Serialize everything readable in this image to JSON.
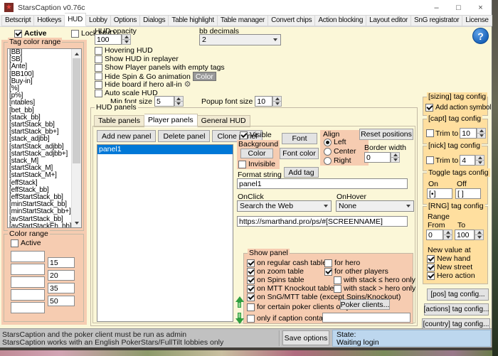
{
  "icons": {
    "app_star": "★",
    "minimize": "–",
    "maximize": "□",
    "close": "×",
    "help": "?",
    "gear": "⚙"
  },
  "colors": {
    "window_bg": "#fbf7d8",
    "panel_pink": "#f6ccb1",
    "panel_orange": "#ffdf9f",
    "selection_blue": "#0078d7",
    "state_bg": "#bdd7ee",
    "status_bg": "#c1c1c1",
    "help_blue": "#1861b8",
    "arrow_green": "#2f9e3f",
    "dark_button_gray": "#989898"
  },
  "window": {
    "title": "StarsCaption v0.76c",
    "tabs": [
      "Betscript",
      "Hotkeys",
      "HUD",
      "Lobby",
      "Options",
      "Dialogs",
      "Table highlight",
      "Table manager",
      "Convert chips",
      "Action blocking",
      "Layout editor",
      "SnG registrator",
      "License"
    ],
    "active_tab": "HUD"
  },
  "topbar": {
    "active_label": "Active",
    "lock_hud_label": "Lock HUD",
    "hud_opacity_label": "HUD opacity",
    "hud_opacity_value": "100",
    "bb_decimals_label": "bb decimals",
    "bb_decimals_value": "2",
    "opt_hovering": "Hovering HUD",
    "opt_replayer": "Show HUD in replayer",
    "opt_empty_tags": "Show Player panels with empty tags",
    "opt_spin_go": "Hide Spin & Go animation",
    "color_button": "Color",
    "opt_hide_board": "Hide board if hero all-in",
    "opt_auto_scale": "Auto scale HUD",
    "min_font_label": "Min font size",
    "min_font_value": "5",
    "popup_font_label": "Popup font size",
    "popup_font_value": "10",
    "checks": {
      "active": true,
      "lock_hud": false,
      "hovering": false,
      "replayer": false,
      "empty_tags": false,
      "spin_go": false,
      "hide_board": false,
      "auto_scale": false
    }
  },
  "tag_color_range": {
    "title": "Tag color range",
    "items": [
      "[BB]",
      "[SB]",
      "[Ante]",
      "[BB100]",
      "[Buy-in]",
      "[%]",
      "[p%]",
      "[ntables]",
      "[bet_bb]",
      "[stack_bb]",
      "[startStack_bb]",
      "[startStack_bb+]",
      "[stack_adjbb]",
      "[startStack_adjbb]",
      "[startStack_adjbb+]",
      "[stack_M]",
      "[startStack_M]",
      "[startStack_M+]",
      "[effStack]",
      "[effStack_bb]",
      "[effStartStack_bb]",
      "[minStartStack_bb]",
      "[minStartStack_bb+]",
      "[avStartStack_bb]",
      "[avStartStackEh_bb]"
    ]
  },
  "color_range": {
    "title": "Color range",
    "active_label": "Active",
    "active_checked": false,
    "values": [
      "15",
      "20",
      "35",
      "50"
    ]
  },
  "hud_panels": {
    "title": "HUD panels",
    "tabs": [
      "Table panels",
      "Player panels",
      "General HUD"
    ],
    "active_tab": "Player panels",
    "add_button": "Add new panel",
    "delete_button": "Delete panel",
    "clone_button": "Clone panel",
    "panels": [
      "panel1"
    ],
    "visible_label": "Visible",
    "visible_checked": true,
    "background_title": "Background",
    "background_color_button": "Color",
    "invisible_label": "Invisible",
    "invisible_checked": false,
    "font_button": "Font",
    "font_color_button": "Font color",
    "add_tag_button": "Add tag",
    "align_title": "Align",
    "align_left": "Left",
    "align_center": "Center",
    "align_right": "Right",
    "align_checked": {
      "left": true,
      "center": false,
      "right": false
    },
    "reset_button": "Reset positions",
    "border_width_label": "Border width",
    "border_width_value": "0",
    "format_label": "Format string",
    "format_value": "panel1",
    "onclick_label": "OnClick",
    "onclick_value": "Search the Web",
    "onhover_label": "OnHover",
    "onhover_value": "None",
    "url_value": "https://smarthand.pro/ps/#[SCREENNAME]",
    "show_panel": {
      "title": "Show panel",
      "opt_regular": "on regular cash table",
      "opt_zoom": "on zoom table",
      "opt_spins": "on Spins table",
      "opt_mtt_ko": "on MTT Knockout table",
      "opt_sng": "on SnG/MTT table (except Spins/Knockout)",
      "opt_hero": "for hero",
      "opt_others": "for other players",
      "opt_stack_le": "with stack ≤ hero only",
      "opt_stack_gt": "with stack > hero only",
      "opt_clients": "for certain poker clients only",
      "clients_button": "Poker clients...",
      "opt_caption": "only if caption contains",
      "caption_value": "",
      "checks": {
        "regular": true,
        "zoom": true,
        "spins": true,
        "mtt_ko": true,
        "sng": true,
        "hero": false,
        "others": true,
        "stack_le": false,
        "stack_gt": false,
        "clients": false,
        "caption": false
      }
    }
  },
  "sidebar_right": {
    "sizing_title": "[sizing] tag config",
    "sizing_option": "Add action symbol",
    "sizing_checked": true,
    "capt_title": "[capt] tag config",
    "capt_trim_label": "Trim to",
    "capt_trim_value": "10",
    "capt_checked": false,
    "nick_title": "[nick] tag config",
    "nick_trim_label": "Trim to",
    "nick_trim_value": "4",
    "nick_checked": false,
    "toggle_title": "Toggle tags config",
    "toggle_on_label": "On",
    "toggle_off_label": "Off",
    "toggle_on_value": "[•]",
    "toggle_off_value": "[ ]",
    "rng_title": "[RNG] tag config",
    "range_label": "Range",
    "from_label": "From",
    "from_value": "0",
    "to_label": "To",
    "to_value": "100",
    "new_value_label": "New value at",
    "opt_new_hand": "New hand",
    "opt_new_street": "New street",
    "opt_hero_action": "Hero action",
    "rng_checks": {
      "new_hand": true,
      "new_street": true,
      "hero_action": true
    },
    "pos_button": "[pos] tag config...",
    "actions_button": "[actions] tag config...",
    "country_button": "[country] tag config..."
  },
  "statusbar": {
    "line1": "StarsCaption and the poker client must be run as admin",
    "line2": "StarsCaption works with an English PokerStars/FullTilt lobbies only",
    "save_button": "Save options",
    "state_label": "State:",
    "state_value": "Waiting login"
  }
}
